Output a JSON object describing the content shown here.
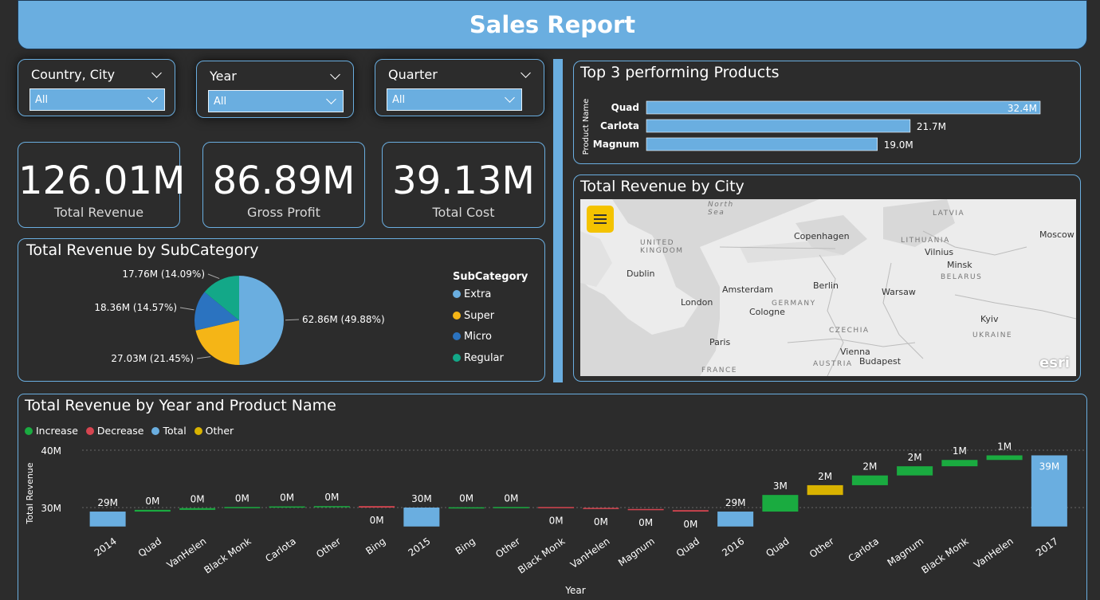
{
  "title": "Sales Report",
  "slicers": [
    {
      "label": "Country, City",
      "value": "All"
    },
    {
      "label": "Year",
      "value": "All"
    },
    {
      "label": "Quarter",
      "value": "All"
    }
  ],
  "kpis": [
    {
      "value": "126.01M",
      "label": "Total Revenue"
    },
    {
      "value": "86.89M",
      "label": "Gross Profit"
    },
    {
      "value": "39.13M",
      "label": "Total Cost"
    }
  ],
  "colors": {
    "accent": "#6aaee0",
    "background": "#2c2c2c",
    "increase": "#1aab40",
    "decrease": "#d64550",
    "total": "#6aaee0",
    "other": "#d9b300",
    "super": "#f5b516",
    "micro": "#2b73c0",
    "regular": "#13a888"
  },
  "pie": {
    "title": "Total Revenue by SubCategory",
    "legend_title": "SubCategory",
    "chart_data": {
      "type": "pie",
      "slices": [
        {
          "name": "Extra",
          "value": 62.86,
          "label": "62.86M (49.88%)"
        },
        {
          "name": "Super",
          "value": 27.03,
          "label": "27.03M (21.45%)"
        },
        {
          "name": "Micro",
          "value": 18.36,
          "label": "18.36M (14.57%)"
        },
        {
          "name": "Regular",
          "value": 17.76,
          "label": "17.76M (14.09%)"
        }
      ]
    }
  },
  "top3": {
    "title": "Top 3 performing Products",
    "axis_label": "Product Name",
    "chart_data": {
      "type": "bar",
      "categories": [
        "Quad",
        "Carlota",
        "Magnum"
      ],
      "values": [
        32.4,
        21.7,
        19.0
      ],
      "labels": [
        "32.4M",
        "21.7M",
        "19.0M"
      ]
    }
  },
  "map": {
    "title": "Total Revenue by City",
    "places": [
      "North Sea",
      "UNITED KINGDOM",
      "Dublin",
      "London",
      "Amsterdam",
      "GERMANY",
      "Cologne",
      "Berlin",
      "Copenhagen",
      "LATVIA",
      "LITHUANIA",
      "Vilnius",
      "Minsk",
      "BELARUS",
      "Moscow",
      "Warsaw",
      "Paris",
      "FRANCE",
      "CZECHIA",
      "Vienna",
      "AUSTRIA",
      "Budapest",
      "Kyiv",
      "UKRAINE"
    ],
    "attribution": "esri"
  },
  "waterfall": {
    "title": "Total Revenue by Year and Product Name",
    "legend": [
      "Increase",
      "Decrease",
      "Total",
      "Other"
    ],
    "xlabel": "Year",
    "ylabel": "Total Revenue",
    "chart_data": {
      "type": "bar",
      "subtype": "waterfall",
      "ylim": [
        26.5,
        40
      ],
      "yticks": [
        "30M",
        "40M"
      ],
      "ytick_values": [
        30,
        40
      ],
      "steps": [
        {
          "category": "2014",
          "kind": "total",
          "start": 26.7,
          "end": 29.3,
          "label": "29M"
        },
        {
          "category": "Quad",
          "kind": "increase",
          "start": 29.3,
          "end": 29.6,
          "label": "0M"
        },
        {
          "category": "VanHelen",
          "kind": "increase",
          "start": 29.6,
          "end": 29.9,
          "label": "0M"
        },
        {
          "category": "Black Monk",
          "kind": "increase",
          "start": 29.9,
          "end": 30.1,
          "label": "0M"
        },
        {
          "category": "Carlota",
          "kind": "increase",
          "start": 30.1,
          "end": 30.2,
          "label": "0M"
        },
        {
          "category": "Other",
          "kind": "increase",
          "start": 30.2,
          "end": 30.25,
          "label": "0M"
        },
        {
          "category": "Bing",
          "kind": "decrease",
          "start": 30.25,
          "end": 30.0,
          "label": "0M"
        },
        {
          "category": "2015",
          "kind": "total",
          "start": 26.7,
          "end": 30.0,
          "label": "30M"
        },
        {
          "category": "Bing",
          "kind": "increase",
          "start": 30.0,
          "end": 30.05,
          "label": "0M"
        },
        {
          "category": "Other",
          "kind": "increase",
          "start": 30.05,
          "end": 30.1,
          "label": "0M"
        },
        {
          "category": "Black Monk",
          "kind": "decrease",
          "start": 30.1,
          "end": 29.95,
          "label": "0M"
        },
        {
          "category": "VanHelen",
          "kind": "decrease",
          "start": 29.95,
          "end": 29.75,
          "label": "0M"
        },
        {
          "category": "Magnum",
          "kind": "decrease",
          "start": 29.75,
          "end": 29.55,
          "label": "0M"
        },
        {
          "category": "Quad",
          "kind": "decrease",
          "start": 29.55,
          "end": 29.3,
          "label": "0M"
        },
        {
          "category": "2016",
          "kind": "total",
          "start": 26.7,
          "end": 29.3,
          "label": "29M"
        },
        {
          "category": "Quad",
          "kind": "increase",
          "start": 29.3,
          "end": 32.2,
          "label": "3M"
        },
        {
          "category": "Other",
          "kind": "other",
          "start": 32.2,
          "end": 33.9,
          "label": "2M"
        },
        {
          "category": "Carlota",
          "kind": "increase",
          "start": 33.9,
          "end": 35.6,
          "label": "2M"
        },
        {
          "category": "Magnum",
          "kind": "increase",
          "start": 35.6,
          "end": 37.2,
          "label": "2M"
        },
        {
          "category": "Black Monk",
          "kind": "increase",
          "start": 37.2,
          "end": 38.3,
          "label": "1M"
        },
        {
          "category": "VanHelen",
          "kind": "increase",
          "start": 38.3,
          "end": 39.1,
          "label": "1M"
        },
        {
          "category": "2017",
          "kind": "total",
          "start": 26.7,
          "end": 39.1,
          "label": "39M"
        }
      ]
    }
  }
}
